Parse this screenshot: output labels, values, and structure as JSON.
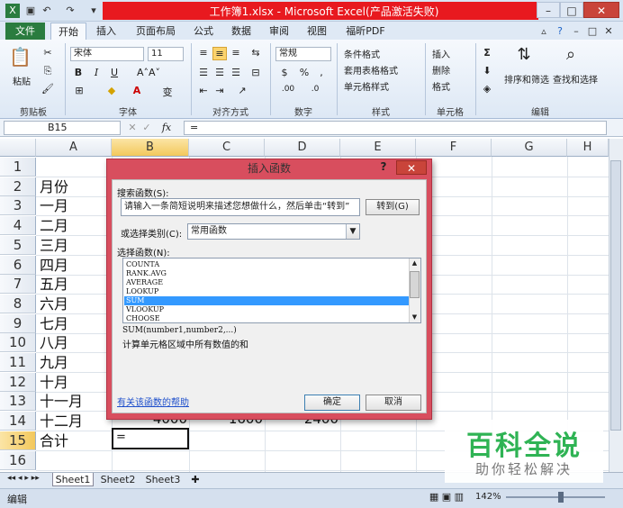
{
  "window": {
    "title": "工作簿1.xlsx - Microsoft Excel(产品激活失败)",
    "minimize": "–",
    "restore": "□",
    "close": "✕"
  },
  "ribbon_tabs": [
    "文件",
    "开始",
    "插入",
    "页面布局",
    "公式",
    "数据",
    "审阅",
    "视图",
    "福昕PDF"
  ],
  "ribbon": {
    "paste": "粘贴",
    "font_name": "宋体",
    "font_size": "11",
    "number_format": "常规",
    "conditional_format": "条件格式",
    "table_format": "套用表格格式",
    "cell_style": "单元格样式",
    "insert": "插入",
    "delete": "删除",
    "format": "格式",
    "sort_filter": "排序和筛选",
    "find_select": "查找和选择",
    "groups": [
      "剪贴板",
      "字体",
      "对齐方式",
      "数字",
      "样式",
      "单元格",
      "编辑"
    ]
  },
  "formula_bar": {
    "name_box": "B15",
    "formula": "="
  },
  "columns": [
    "A",
    "B",
    "C",
    "D",
    "E",
    "F",
    "G",
    "H"
  ],
  "rows": [
    "1",
    "2",
    "3",
    "4",
    "5",
    "6",
    "7",
    "8",
    "9",
    "10",
    "11",
    "12",
    "13",
    "14",
    "15",
    "16"
  ],
  "cells_a": [
    "",
    "月份",
    "一月",
    "二月",
    "三月",
    "四月",
    "五月",
    "六月",
    "七月",
    "八月",
    "九月",
    "十月",
    "十一月",
    "十二月",
    "合计",
    ""
  ],
  "row14_values": {
    "b": "4000",
    "c": "1600",
    "d": "2400"
  },
  "active_cell_value": "=",
  "dialog": {
    "title": "插入函数",
    "help": "?",
    "close": "✕",
    "search_label": "搜索函数(S):",
    "search_value": "请输入一条简短说明来描述您想做什么，然后单击“转到”",
    "goto": "转到(G)",
    "category_label": "或选择类别(C):",
    "category_value": "常用函数",
    "select_label": "选择函数(N):",
    "functions": [
      "COUNTA",
      "RANK.AVG",
      "AVERAGE",
      "LOOKUP",
      "SUM",
      "VLOOKUP",
      "CHOOSE"
    ],
    "selected_function": "SUM",
    "signature": "SUM(number1,number2,...)",
    "description": "计算单元格区域中所有数值的和",
    "help_link": "有关该函数的帮助",
    "ok": "确定",
    "cancel": "取消"
  },
  "sheets": [
    "Sheet1",
    "Sheet2",
    "Sheet3"
  ],
  "status": {
    "mode": "编辑",
    "zoom": "142%"
  },
  "watermark": {
    "title": "百科全说",
    "subtitle": "助你轻松解决"
  }
}
